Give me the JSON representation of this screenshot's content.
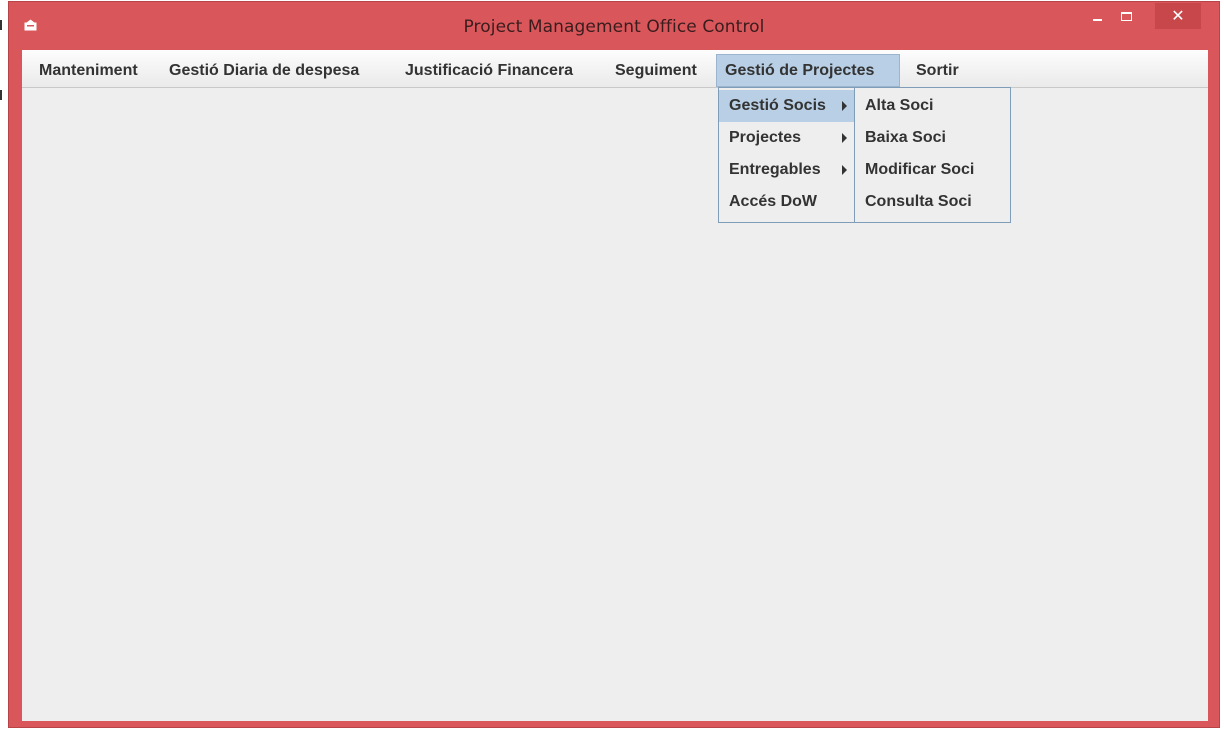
{
  "window": {
    "title": "Project Management Office Control",
    "app_icon": "app-icon",
    "controls": {
      "minimize": "–",
      "maximize": "☐",
      "close": "✕"
    },
    "colors": {
      "frame": "#d9575b",
      "client": "#eeeeee",
      "highlight": "#b8cfe5"
    }
  },
  "menubar": {
    "items": [
      {
        "label": "Manteniment"
      },
      {
        "label": "Gestió Diaria de despesa"
      },
      {
        "label": "Justificació Financera"
      },
      {
        "label": "Seguiment"
      },
      {
        "label": "Gestió de Projectes"
      },
      {
        "label": "Sortir"
      }
    ]
  },
  "projectes_menu": {
    "items": [
      {
        "label": "Gestió Socis",
        "has_submenu": true
      },
      {
        "label": "Projectes",
        "has_submenu": true
      },
      {
        "label": "Entregables",
        "has_submenu": true
      },
      {
        "label": "Accés DoW",
        "has_submenu": false
      }
    ]
  },
  "socis_submenu": {
    "items": [
      {
        "label": "Alta Soci"
      },
      {
        "label": "Baixa Soci"
      },
      {
        "label": "Modificar Soci"
      },
      {
        "label": "Consulta Soci"
      }
    ]
  }
}
